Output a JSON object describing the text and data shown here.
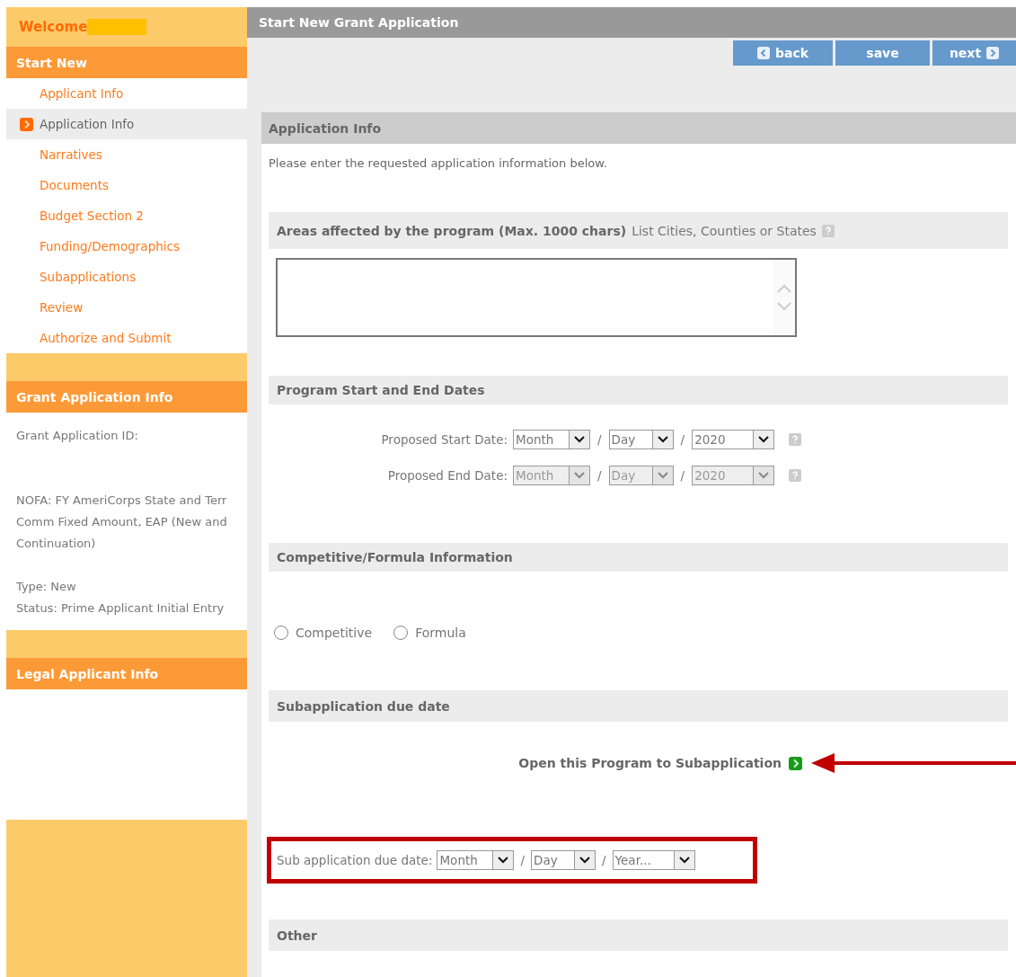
{
  "sidebar": {
    "welcome": "Welcome",
    "nav_title": "Start New",
    "nav_items": [
      {
        "label": "Applicant Info",
        "selected": false
      },
      {
        "label": "Application Info",
        "selected": true
      },
      {
        "label": "Narratives",
        "selected": false
      },
      {
        "label": "Documents",
        "selected": false
      },
      {
        "label": "Budget Section 2",
        "selected": false
      },
      {
        "label": "Funding/Demographics",
        "selected": false
      },
      {
        "label": "Subapplications",
        "selected": false
      },
      {
        "label": "Review",
        "selected": false
      },
      {
        "label": "Authorize and Submit",
        "selected": false
      }
    ],
    "grant_info": {
      "title": "Grant Application Info",
      "id_label": "Grant Application ID:",
      "nofa": "NOFA: FY AmeriCorps State and Terr Comm Fixed Amount, EAP (New and Continuation)",
      "type": "Type: New",
      "status": "Status: Prime Applicant Initial Entry"
    },
    "legal_info": {
      "title": "Legal Applicant Info"
    }
  },
  "main": {
    "title": "Start New Grant Application",
    "buttons": [
      {
        "label": "back",
        "kind": "back"
      },
      {
        "label": "save",
        "kind": "save"
      },
      {
        "label": "next",
        "kind": "next"
      }
    ],
    "section_title": "Application Info",
    "intro": "Please enter the requested application information below.",
    "sections": [
      {
        "kind": "textarea",
        "title": "Areas affected by the program (Max. 1000 chars)",
        "hint": "List Cities, Counties or States"
      },
      {
        "kind": "dates",
        "title": "Program Start and End Dates",
        "rows": [
          {
            "label": "Proposed Start Date:",
            "disabled": false,
            "parts": [
              {
                "kind": "select",
                "value": "Month"
              },
              {
                "kind": "sep",
                "text": "/"
              },
              {
                "kind": "select",
                "value": "Day"
              },
              {
                "kind": "sep",
                "text": "/"
              },
              {
                "kind": "select",
                "value": "2020"
              }
            ]
          },
          {
            "label": "Proposed End Date:",
            "disabled": true,
            "parts": [
              {
                "kind": "select",
                "value": "Month"
              },
              {
                "kind": "sep",
                "text": "/"
              },
              {
                "kind": "select",
                "value": "Day"
              },
              {
                "kind": "sep",
                "text": "/"
              },
              {
                "kind": "select",
                "value": "2020"
              }
            ]
          }
        ]
      },
      {
        "kind": "radios",
        "title": "Competitive/Formula Information",
        "options": [
          {
            "label": "Competitive",
            "selected": false
          },
          {
            "label": "Formula",
            "selected": false
          }
        ]
      },
      {
        "kind": "subapp",
        "title": "Subapplication due date",
        "link": "Open this Program to Subapplication",
        "callout": true,
        "row": {
          "label": "Sub application due date:",
          "highlighted": true,
          "disabled": false,
          "parts": [
            {
              "kind": "select",
              "value": "Month"
            },
            {
              "kind": "sep",
              "text": "/"
            },
            {
              "kind": "select",
              "value": "Day"
            },
            {
              "kind": "sep",
              "text": "/"
            },
            {
              "kind": "select",
              "value": "Year..."
            }
          ]
        }
      },
      {
        "kind": "plain",
        "title": "Other"
      }
    ]
  }
}
